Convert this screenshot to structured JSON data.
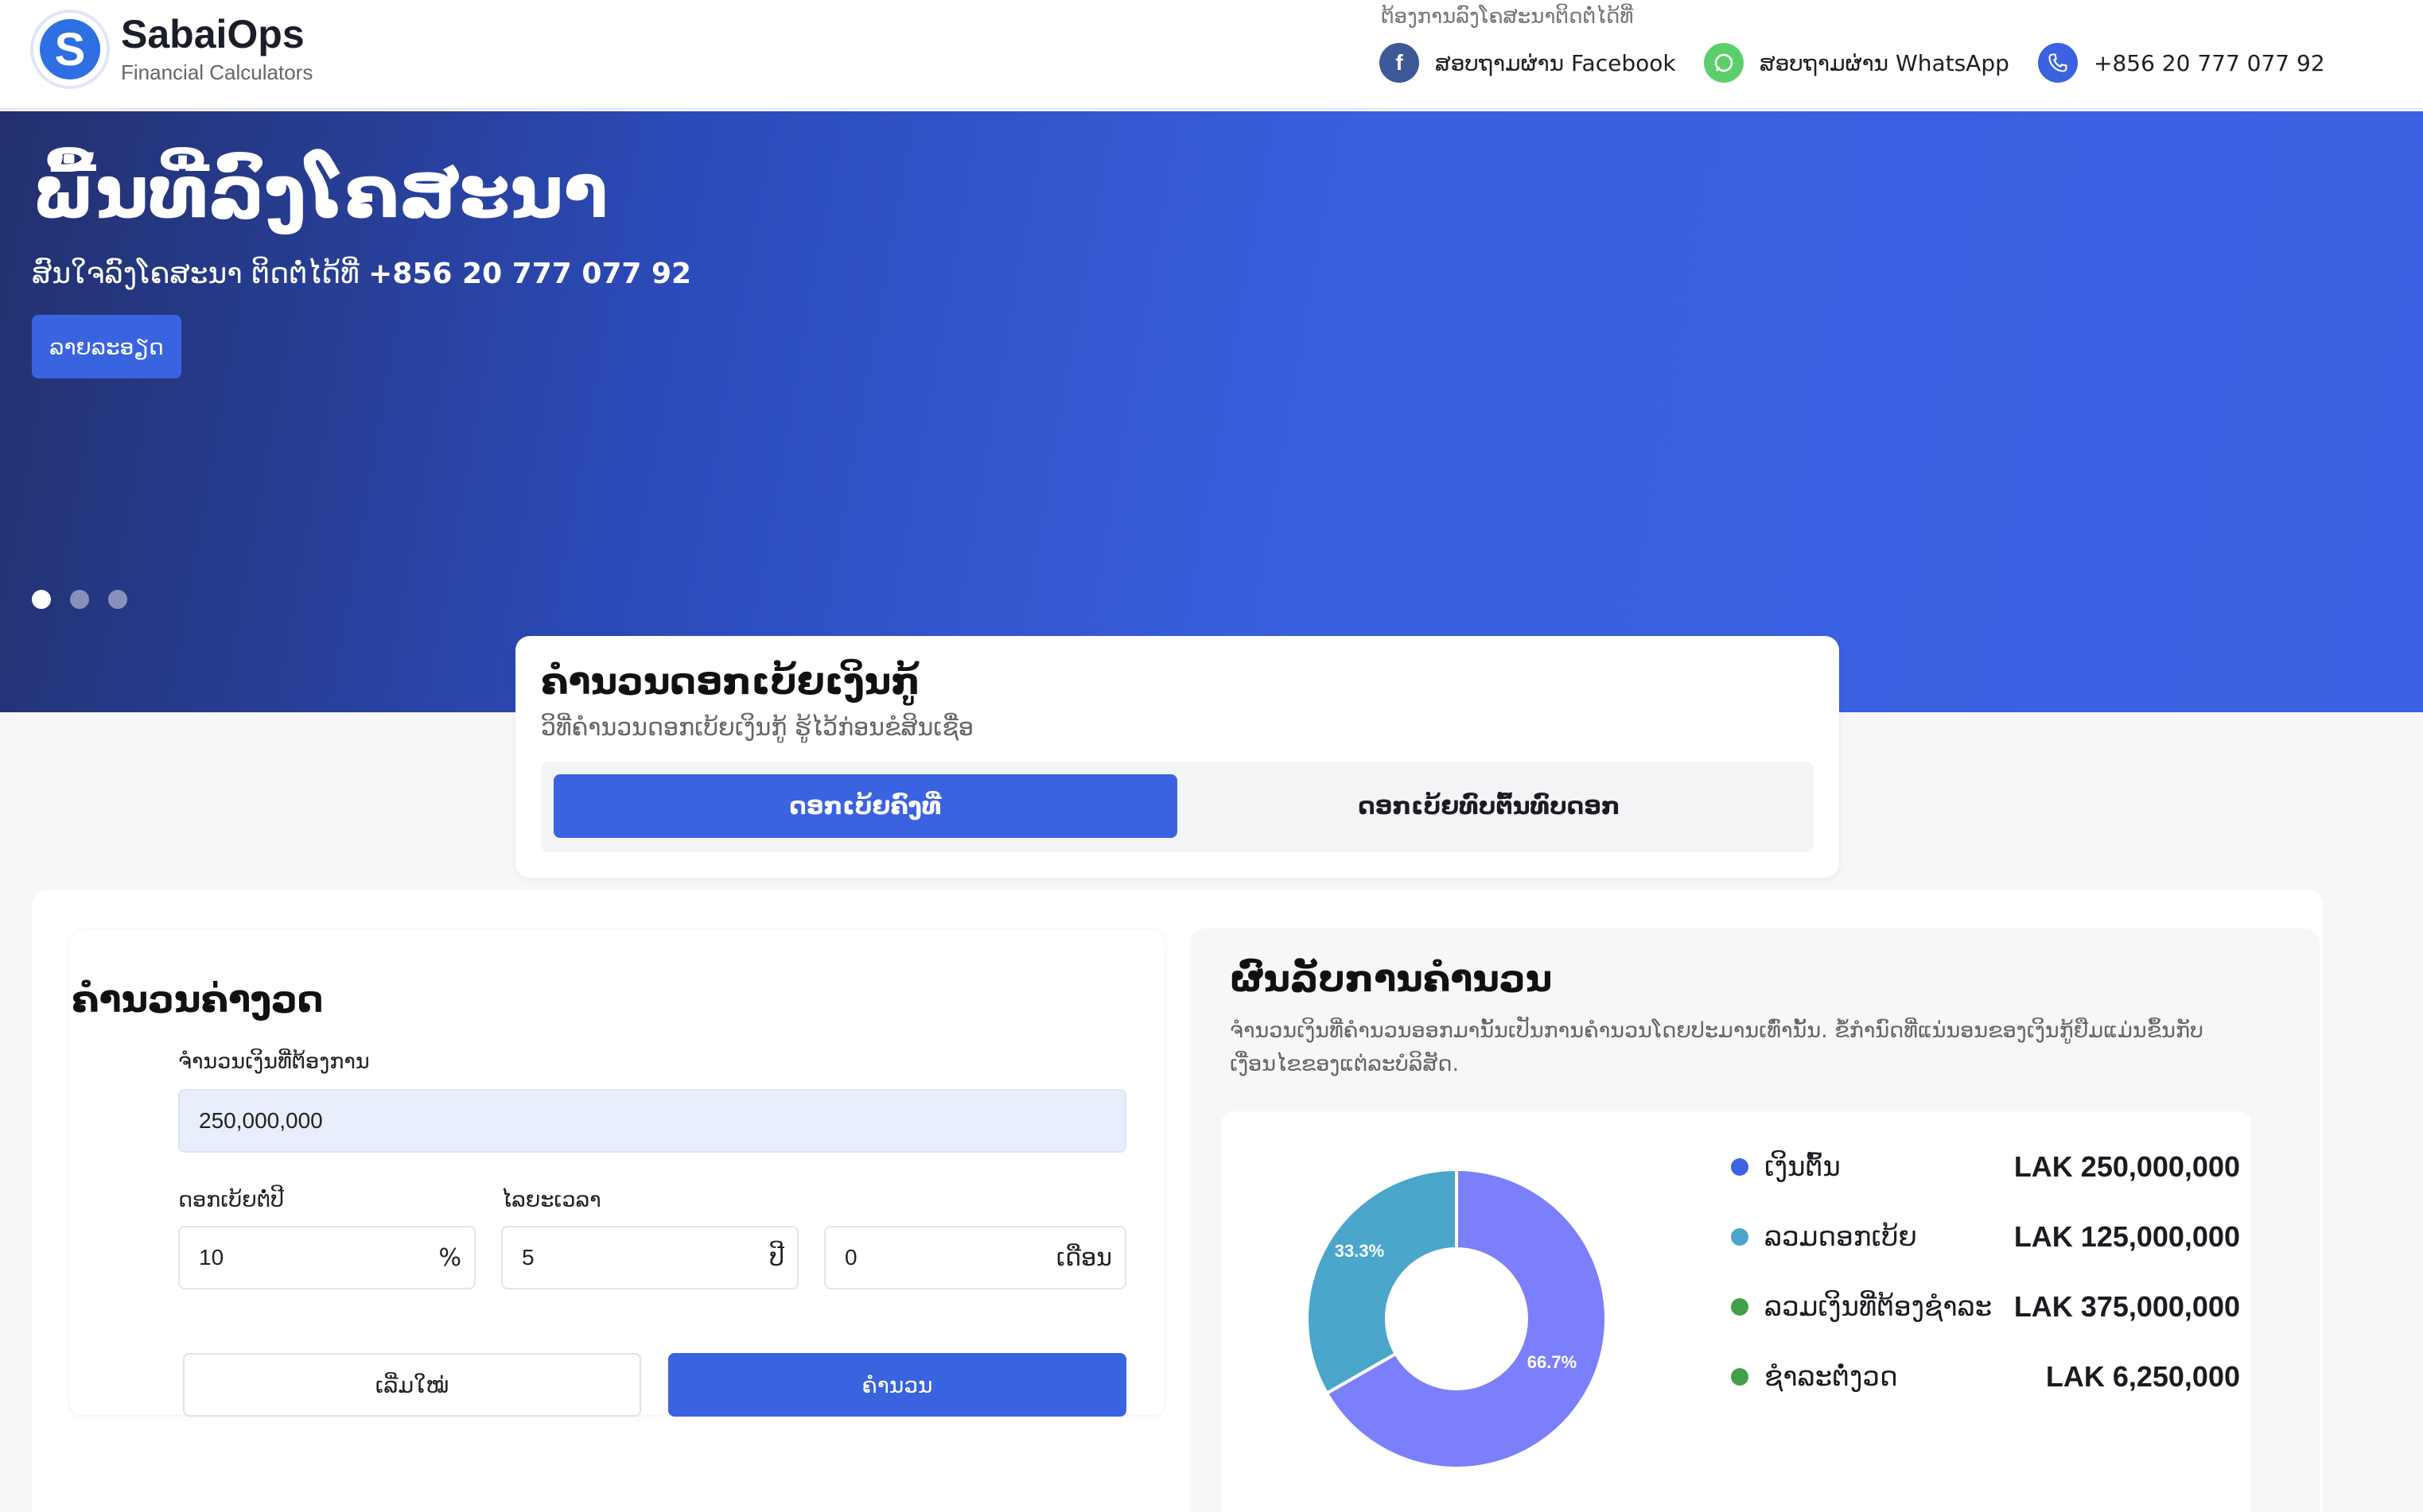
{
  "brand": {
    "name": "SabaiOps",
    "subtitle": "Financial Calculators"
  },
  "header": {
    "contact_caption": "ຕ້ອງການລົງໂຄສະນາຕິດຕໍ່ໄດ້ທີ່",
    "facebook_label": "ສອບຖາມຜ່ານ Facebook",
    "whatsapp_label": "ສອບຖາມຜ່ານ WhatsApp",
    "phone_label": "+856 20 777 077 92"
  },
  "hero": {
    "title": "ພື້ນທີ່ລົງໂຄສະນາ",
    "subtitle_prefix": "ສົນໃຈລົງໂຄສະນາ ຕິດຕໍ່ໄດ້ທີ່ ",
    "subtitle_phone": "+856 20 777 077 92",
    "button_label": "ລາຍລະອຽດ",
    "slide_count": 3,
    "active_slide": 1
  },
  "calculator": {
    "title": "ຄຳນວນດອກເບ້ຍເງິນກູ້",
    "description": "ວິທີ່ຄຳນວນດອກເບ້ຍເງິນກູ້ ຮູ້ໄວ້ກ່ອນຂໍສິນເຊື່ອ",
    "tabs": [
      {
        "label": "ດອກເບ້ຍຄົງທີ່",
        "active": true
      },
      {
        "label": "ດອກເບ້ຍທົບຕົ້ນທົບດອກ",
        "active": false
      }
    ]
  },
  "form": {
    "title": "ຄຳນວນຄ່າງວດ",
    "amount_label": "ຈຳນວນເງິນທີ່ຕ້ອງການ",
    "amount_value": "250,000,000",
    "rate_label": "ດອກເບ້ຍຕໍ່ປີ",
    "rate_value": "10",
    "rate_suffix": "%",
    "term_label": "ໄລຍະເວລາ",
    "years_value": "5",
    "years_suffix": "ປີ",
    "months_value": "0",
    "months_suffix": "ເດືອນ",
    "reset_label": "ເລີ່ມໃໝ່",
    "calculate_label": "ຄຳນວນ"
  },
  "results": {
    "title": "ຜົນລັບການຄຳນວນ",
    "note": "ຈຳນວນເງິນທີ່ຄຳນວນອອກມານັ້ນເປັນການຄຳນວນໂດຍປະມານເທົ່ານັ້ນ. ຂໍ້ກຳນົດທີ່ແນ່ນອນຂອງເງິນກູ້ຢືມແມ່ນຂຶ້ນກັບເງື່ອນໄຂຂອງແຕ່ລະບໍລິສັດ.",
    "items": [
      {
        "label": "ເງິນຕົ້ນ",
        "value": "LAK 250,000,000",
        "color": "#3d63e0"
      },
      {
        "label": "ລວມດອກເບ້ຍ",
        "value": "LAK 125,000,000",
        "color": "#4aa6cb"
      },
      {
        "label": "ລວມເງິນທີ່ຕ້ອງຊຳລະ",
        "value": "LAK 375,000,000",
        "color": "#43a047"
      },
      {
        "label": "ຊຳລະຕໍ່ງວດ",
        "value": "LAK 6,250,000",
        "color": "#43a047"
      }
    ]
  },
  "chart_data": {
    "type": "pie",
    "categories": [
      "ເງິນຕົ້ນ",
      "ລວມດອກເບ້ຍ"
    ],
    "values": [
      66.7,
      33.3
    ],
    "data_labels": [
      "66.7%",
      "33.3%"
    ],
    "colors": [
      "#7b7ffb",
      "#4aa6cb"
    ]
  }
}
